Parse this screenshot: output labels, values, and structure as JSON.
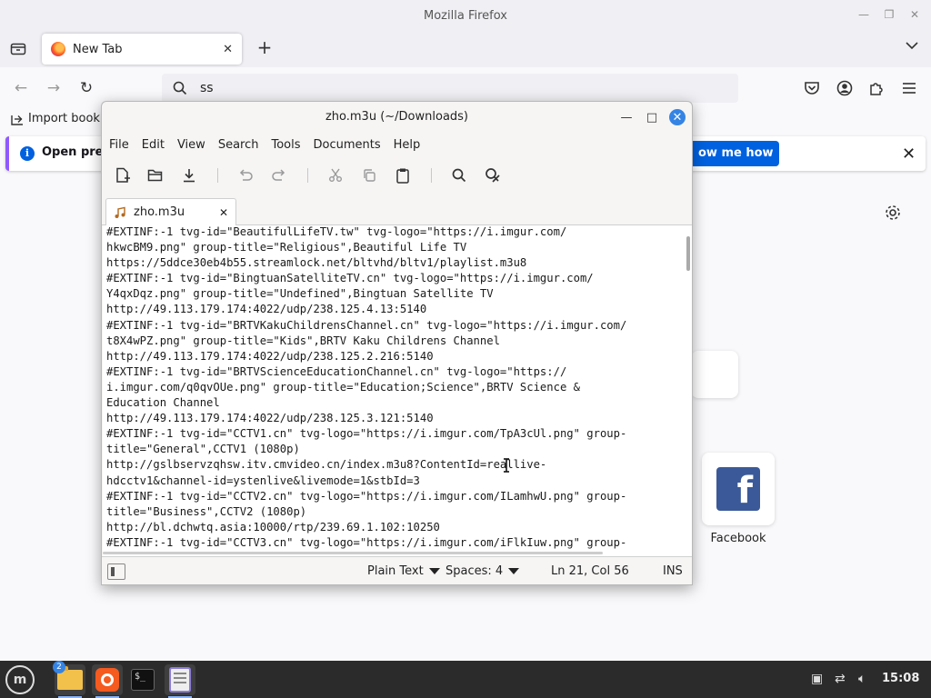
{
  "firefox": {
    "window_title": "Mozilla Firefox",
    "tab_label": "New Tab",
    "url_text": "ss",
    "bookmark_label": "Import bookm",
    "notification_text": "Open previ",
    "notification_button": "ow me how",
    "shortcut_label": "Facebook",
    "accent_color": "#0061e0"
  },
  "editor": {
    "window_title": "zho.m3u (~/Downloads)",
    "menus": [
      "File",
      "Edit",
      "View",
      "Search",
      "Tools",
      "Documents",
      "Help"
    ],
    "tab_label": "zho.m3u",
    "lines": [
      "#EXTINF:-1 tvg-id=\"BeautifulLifeTV.tw\" tvg-logo=\"https://i.imgur.com/",
      "hkwcBM9.png\" group-title=\"Religious\",Beautiful Life TV",
      "https://5ddce30eb4b55.streamlock.net/bltvhd/bltv1/playlist.m3u8",
      "#EXTINF:-1 tvg-id=\"BingtuanSatelliteTV.cn\" tvg-logo=\"https://i.imgur.com/",
      "Y4qxDqz.png\" group-title=\"Undefined\",Bingtuan Satellite TV",
      "http://49.113.179.174:4022/udp/238.125.4.13:5140",
      "#EXTINF:-1 tvg-id=\"BRTVKakuChildrensChannel.cn\" tvg-logo=\"https://i.imgur.com/",
      "t8X4wPZ.png\" group-title=\"Kids\",BRTV Kaku Childrens Channel",
      "http://49.113.179.174:4022/udp/238.125.2.216:5140",
      "#EXTINF:-1 tvg-id=\"BRTVScienceEducationChannel.cn\" tvg-logo=\"https://",
      "i.imgur.com/q0qvOUe.png\" group-title=\"Education;Science\",BRTV Science &",
      "Education Channel",
      "http://49.113.179.174:4022/udp/238.125.3.121:5140",
      "#EXTINF:-1 tvg-id=\"CCTV1.cn\" tvg-logo=\"https://i.imgur.com/TpA3cUl.png\" group-",
      "title=\"General\",CCTV1 (1080p)",
      "http://gslbservzqhsw.itv.cmvideo.cn/index.m3u8?ContentId=reallive-",
      "hdcctv1&channel-id=ystenlive&livemode=1&stbId=3",
      "#EXTINF:-1 tvg-id=\"CCTV2.cn\" tvg-logo=\"https://i.imgur.com/ILamhwU.png\" group-",
      "title=\"Business\",CCTV2 (1080p)",
      "http://bl.dchwtq.asia:10000/rtp/239.69.1.102:10250",
      "#EXTINF:-1 tvg-id=\"CCTV3.cn\" tvg-logo=\"https://i.imgur.com/iFlkIuw.png\" group-"
    ],
    "status": {
      "language": "Plain Text",
      "spaces": "Spaces: 4",
      "position": "Ln 21, Col 56",
      "mode": "INS"
    }
  },
  "taskbar": {
    "files_badge": "2",
    "clock": "15:08"
  }
}
